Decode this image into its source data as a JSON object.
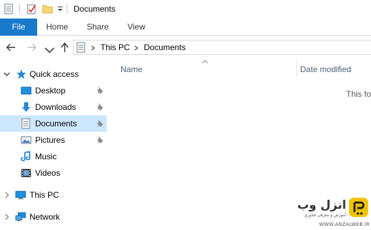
{
  "window": {
    "title": "Documents"
  },
  "ribbon": {
    "tabs": [
      {
        "label": "File"
      },
      {
        "label": "Home"
      },
      {
        "label": "Share"
      },
      {
        "label": "View"
      }
    ]
  },
  "address": {
    "crumbs": [
      "This PC",
      "Documents"
    ]
  },
  "sidebar": {
    "quick_access": "Quick access",
    "items": [
      {
        "label": "Desktop",
        "icon": "desktop-icon",
        "pinned": true
      },
      {
        "label": "Downloads",
        "icon": "download-icon",
        "pinned": true
      },
      {
        "label": "Documents",
        "icon": "documents-icon",
        "pinned": true,
        "selected": true
      },
      {
        "label": "Pictures",
        "icon": "pictures-icon",
        "pinned": true
      },
      {
        "label": "Music",
        "icon": "music-icon",
        "pinned": false
      },
      {
        "label": "Videos",
        "icon": "videos-icon",
        "pinned": false
      }
    ],
    "this_pc": "This PC",
    "network": "Network"
  },
  "content": {
    "columns": [
      "Name",
      "Date modified"
    ],
    "empty_message": "This fo"
  },
  "watermark": {
    "brand": "انزل وب",
    "tagline": "آموزش و معرفی فناوری",
    "url": "WWW.ANZALWEB.IR"
  },
  "colors": {
    "accent": "#1979ca",
    "selection": "#cce8ff",
    "header_text": "#4c607a"
  }
}
